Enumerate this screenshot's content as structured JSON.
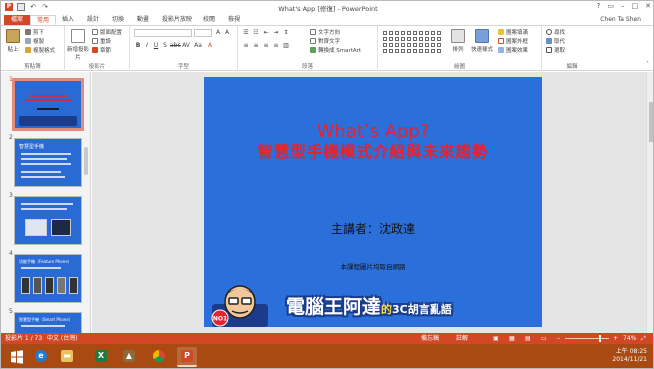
{
  "window": {
    "title": "What's App [修復] - PowerPoint",
    "user": "Chen Ta Shen",
    "qat": [
      "ppt-logo-icon",
      "save-icon",
      "undo-icon",
      "redo-icon"
    ]
  },
  "tabs": [
    "檔案",
    "常用",
    "插入",
    "設計",
    "切換",
    "動畫",
    "投影片放映",
    "校閱",
    "檢視"
  ],
  "active_tab": "常用",
  "ribbon": {
    "groups": [
      "剪貼簿",
      "投影片",
      "字型",
      "段落",
      "繪圖",
      "編輯"
    ],
    "clipboard": {
      "paste": "貼上",
      "cut": "剪下",
      "copy": "複製",
      "format_painter": "複製格式"
    },
    "slides": {
      "new_slide": "新增投影片",
      "layout": "版面配置",
      "reset": "重設",
      "section": "章節"
    },
    "paragraph": {
      "text_direction": "文字方向",
      "align_text": "對齊文字",
      "smartart": "轉換成 SmartArt"
    },
    "drawing": {
      "arrange": "排列",
      "quick_styles": "快速樣式",
      "fill": "圖案填滿",
      "outline": "圖案外框",
      "effects": "圖案效果"
    },
    "editing": {
      "find": "尋找",
      "replace": "取代",
      "select": "選取"
    }
  },
  "thumbnails": [
    {
      "num": "1",
      "selected": true,
      "caption": ""
    },
    {
      "num": "2",
      "selected": false,
      "caption": "智慧型手機"
    },
    {
      "num": "3",
      "selected": false,
      "caption": ""
    },
    {
      "num": "4",
      "selected": false,
      "caption": "功能手機（Feature Phone）"
    },
    {
      "num": "5",
      "selected": false,
      "caption": "智慧型手機（Smart Phone）"
    }
  ],
  "slide": {
    "title": "What’s App?",
    "subtitle": "智慧型手機模式介紹與未來趨勢",
    "speaker": "主講者：沈政達",
    "note": "本課程圖片均取自網路",
    "banner_main": "電腦王阿達",
    "banner_de": "的",
    "banner_tail": "3C胡言亂語",
    "badge": "NO1"
  },
  "statusbar": {
    "slide_count": "投影片 1 / 73",
    "language": "中文 (台灣)",
    "notes": "備忘稿",
    "comments": "註解",
    "zoom": "74%"
  },
  "taskbar": {
    "apps": [
      "windows-start-icon",
      "internet-explorer-icon",
      "file-explorer-icon",
      "excel-icon",
      "photo-viewer-icon",
      "chrome-icon",
      "powerpoint-icon"
    ],
    "time": "上午 08:25",
    "date": "2014/11/21"
  },
  "colors": {
    "accent": "#d24726",
    "slide_bg": "#2b6fdb",
    "slide_title": "#e4232e",
    "taskbar": "#a84a12"
  }
}
